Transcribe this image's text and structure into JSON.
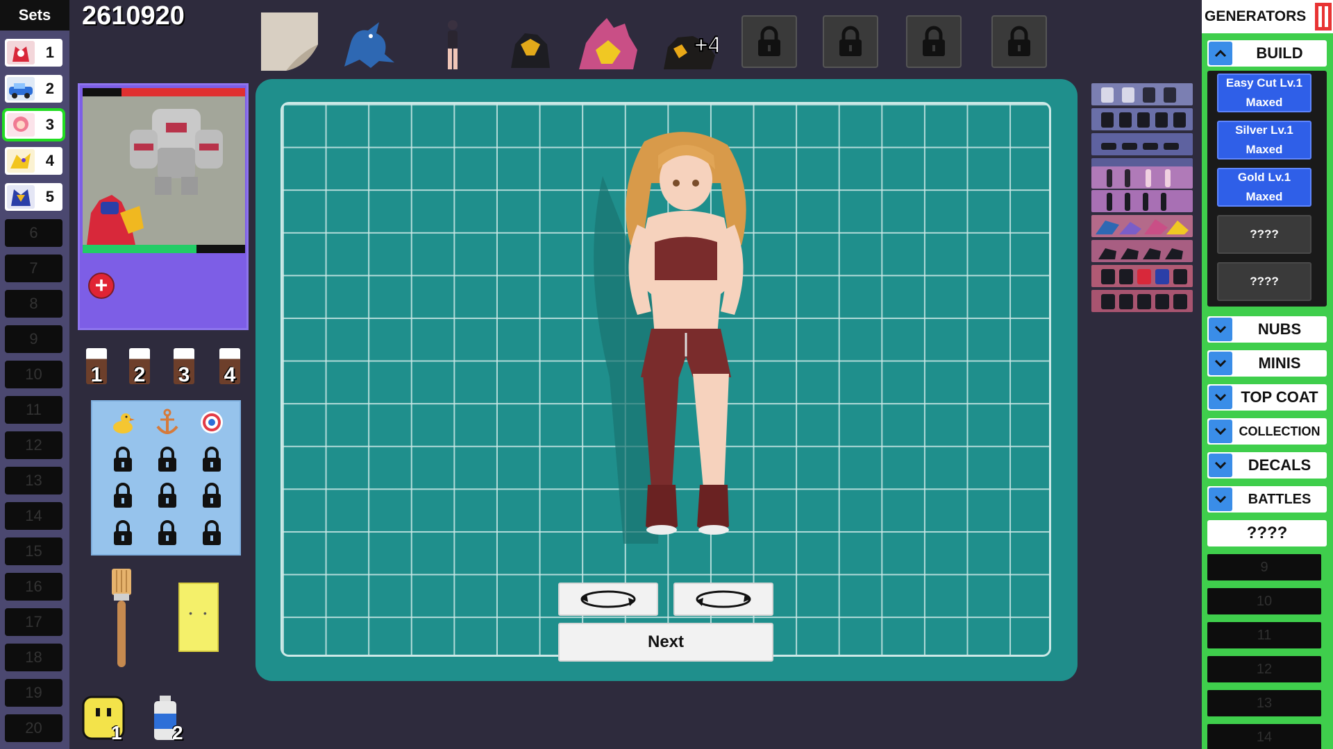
{
  "score": "2610920",
  "sets": {
    "header": "Sets",
    "selected": "3",
    "slots": [
      {
        "label": "1",
        "filled": true,
        "thumb": "red-robot"
      },
      {
        "label": "2",
        "filled": true,
        "thumb": "blue-car"
      },
      {
        "label": "3",
        "filled": true,
        "thumb": "pink-girl"
      },
      {
        "label": "4",
        "filled": true,
        "thumb": "yellow-beast"
      },
      {
        "label": "5",
        "filled": true,
        "thumb": "blue-gold-mech"
      },
      {
        "label": "6",
        "filled": false
      },
      {
        "label": "7",
        "filled": false
      },
      {
        "label": "8",
        "filled": false
      },
      {
        "label": "9",
        "filled": false
      },
      {
        "label": "10",
        "filled": false
      },
      {
        "label": "11",
        "filled": false
      },
      {
        "label": "12",
        "filled": false
      },
      {
        "label": "13",
        "filled": false
      },
      {
        "label": "14",
        "filled": false
      },
      {
        "label": "15",
        "filled": false
      },
      {
        "label": "16",
        "filled": false
      },
      {
        "label": "17",
        "filled": false
      },
      {
        "label": "18",
        "filled": false
      },
      {
        "label": "19",
        "filled": false
      },
      {
        "label": "20",
        "filled": false
      }
    ]
  },
  "top_bar": {
    "items": [
      "paper-sheet",
      "blue-dragon-figure",
      "girl-figure",
      "black-gold-mech",
      "pink-gold-dragon",
      "black-gold-beast"
    ],
    "extra_count_label": "+4",
    "locked_slots": 4
  },
  "battle_preview": {
    "enemy_health": 0.76,
    "player_health": 0.7,
    "add_label": "+"
  },
  "paint_cans": [
    "1",
    "2",
    "3",
    "4"
  ],
  "decals": {
    "unlocked": [
      "duck-icon",
      "anchor-icon",
      "target-icon"
    ],
    "locked_count": 9
  },
  "tools": {
    "brush": "brush-icon",
    "sponge": "sponge-icon"
  },
  "inventory": [
    {
      "icon": "sponge-face-icon",
      "count": "1"
    },
    {
      "icon": "spray-can-icon",
      "count": "2"
    }
  ],
  "canvas": {
    "rotate_left_icon": "rotate-ccw-icon",
    "rotate_right_icon": "rotate-cw-icon",
    "next_label": "Next"
  },
  "mini_list": [
    "row-1",
    "row-2",
    "row-3",
    "row-4",
    "row-5",
    "row-6",
    "row-7",
    "row-8",
    "row-9",
    "row-10"
  ],
  "generators": {
    "header": "GENERATORS",
    "build": {
      "label": "BUILD",
      "upgrades": [
        {
          "line1": "Easy Cut Lv.1",
          "line2": "Maxed"
        },
        {
          "line1": "Silver Lv.1",
          "line2": "Maxed"
        },
        {
          "line1": "Gold Lv.1",
          "line2": "Maxed"
        },
        {
          "line1": "????",
          "line2": ""
        },
        {
          "line1": "????",
          "line2": ""
        }
      ]
    },
    "categories": [
      "NUBS",
      "MINIS",
      "TOP COAT",
      "COLLECTION",
      "DECALS",
      "BATTLES"
    ],
    "unknown_label": "????",
    "empty_slots": [
      "9",
      "10",
      "11",
      "12",
      "13",
      "14"
    ]
  },
  "colors": {
    "background": "#2e2b3d",
    "sets_panel": "#4b4870",
    "canvas": "#1f8f8c",
    "generators_panel": "#3fce4c",
    "upgrade_button": "#2f5fe8",
    "selected_outline": "#22dd22"
  }
}
